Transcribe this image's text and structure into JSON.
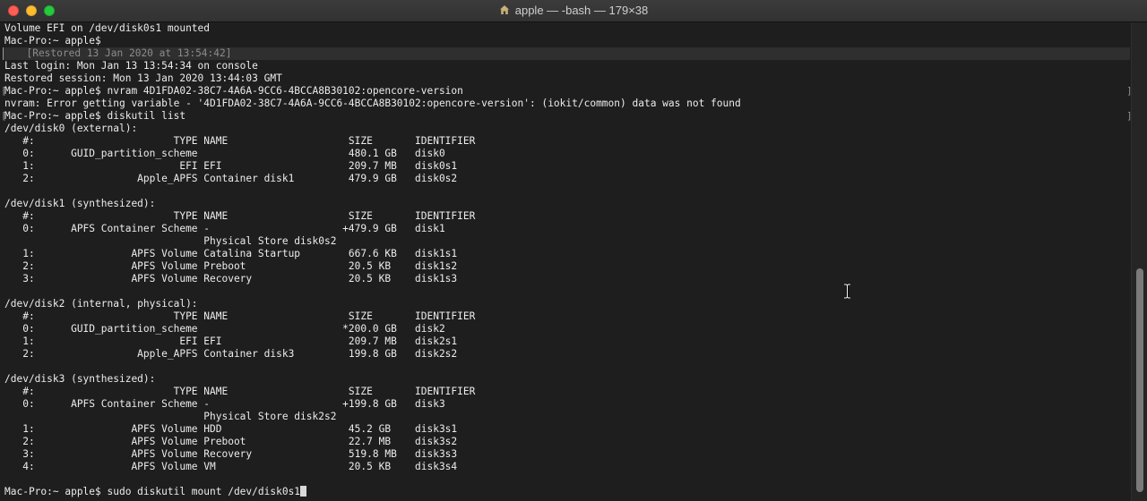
{
  "window": {
    "title": "apple — -bash — 179×38"
  },
  "icons": {
    "home": "home-icon",
    "text_cursor": "i-beam-cursor-icon"
  },
  "terminal": {
    "lines": [
      "Volume EFI on /dev/disk0s1 mounted",
      "Mac-Pro:~ apple$",
      "  [Restored 13 Jan 2020 at 13:54:42]",
      "Last login: Mon Jan 13 13:54:34 on console",
      "Restored session: Mon 13 Jan 2020 13:44:03 GMT",
      "Mac-Pro:~ apple$ nvram 4D1FDA02-38C7-4A6A-9CC6-4BCCA8B30102:opencore-version",
      "nvram: Error getting variable - '4D1FDA02-38C7-4A6A-9CC6-4BCCA8B30102:opencore-version': (iokit/common) data was not found",
      "Mac-Pro:~ apple$ diskutil list",
      "/dev/disk0 (external):",
      "   #:                       TYPE NAME                    SIZE       IDENTIFIER",
      "   0:      GUID_partition_scheme                         480.1 GB   disk0",
      "   1:                        EFI EFI                     209.7 MB   disk0s1",
      "   2:                 Apple_APFS Container disk1         479.9 GB   disk0s2",
      "",
      "/dev/disk1 (synthesized):",
      "   #:                       TYPE NAME                    SIZE       IDENTIFIER",
      "   0:      APFS Container Scheme -                      +479.9 GB   disk1",
      "                                 Physical Store disk0s2",
      "   1:                APFS Volume Catalina Startup        667.6 KB   disk1s1",
      "   2:                APFS Volume Preboot                 20.5 KB    disk1s2",
      "   3:                APFS Volume Recovery                20.5 KB    disk1s3",
      "",
      "/dev/disk2 (internal, physical):",
      "   #:                       TYPE NAME                    SIZE       IDENTIFIER",
      "   0:      GUID_partition_scheme                        *200.0 GB   disk2",
      "   1:                        EFI EFI                     209.7 MB   disk2s1",
      "   2:                 Apple_APFS Container disk3         199.8 GB   disk2s2",
      "",
      "/dev/disk3 (synthesized):",
      "   #:                       TYPE NAME                    SIZE       IDENTIFIER",
      "   0:      APFS Container Scheme -                      +199.8 GB   disk3",
      "                                 Physical Store disk2s2",
      "   1:                APFS Volume HDD                     45.2 GB    disk3s1",
      "   2:                APFS Volume Preboot                 22.7 MB    disk3s2",
      "   3:                APFS Volume Recovery                519.8 MB   disk3s3",
      "   4:                APFS Volume VM                      20.5 KB    disk3s4",
      "",
      "Mac-Pro:~ apple$ sudo diskutil mount /dev/disk0s1"
    ]
  }
}
